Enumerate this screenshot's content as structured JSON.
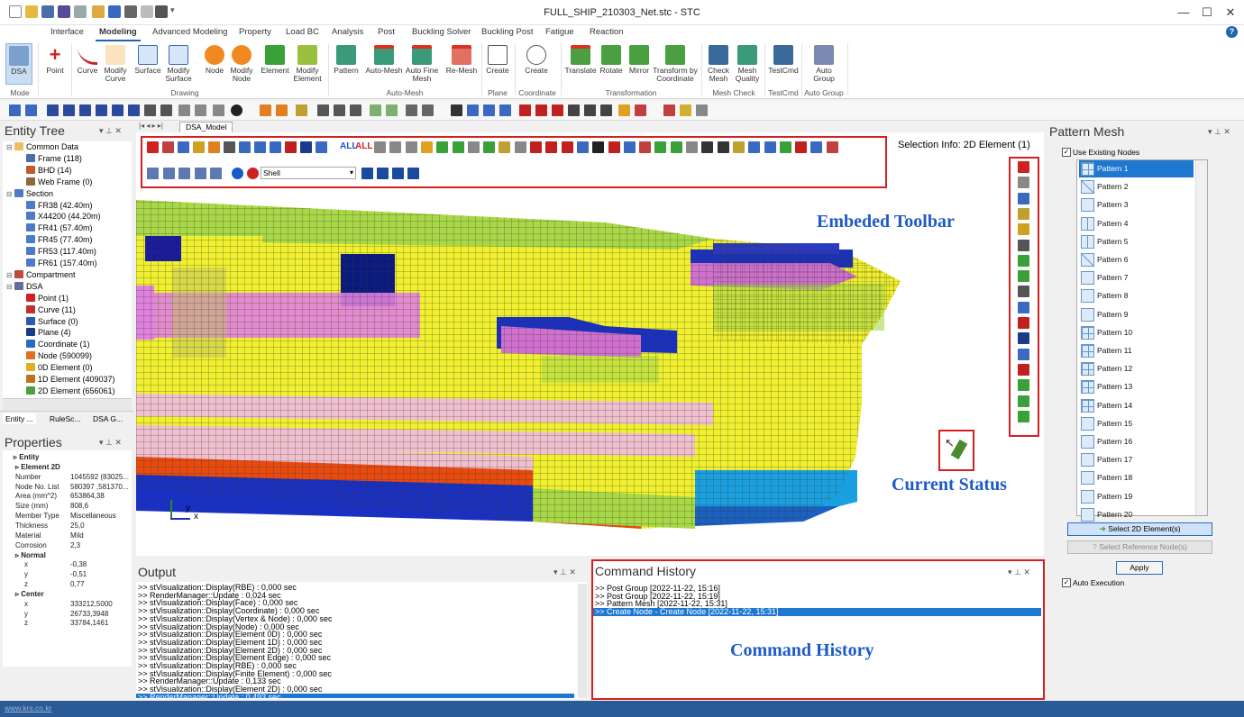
{
  "window": {
    "title": "FULL_SHIP_210303_Net.stc - STC"
  },
  "ribbon_tabs": [
    "Interface",
    "Modeling",
    "Advanced Modeling",
    "Property",
    "Load BC",
    "Analysis",
    "Post",
    "Buckling Solver",
    "Buckling Post",
    "Fatigue",
    "Reaction"
  ],
  "active_tab": "Modeling",
  "ribbon": {
    "dsa": "DSA",
    "point": "Point",
    "curve": "Curve",
    "modify_curve": "Modify Curve",
    "surface": "Surface",
    "modify_surface": "Modify Surface",
    "node": "Node",
    "modify_node": "Modify Node",
    "element": "Element",
    "modify_element": "Modify Element",
    "pattern": "Pattern",
    "auto_mesh": "Auto-Mesh",
    "auto_fine_mesh": "Auto Fine Mesh",
    "re_mesh": "Re-Mesh",
    "create_plane": "Create",
    "create_coord": "Create",
    "translate": "Translate",
    "rotate": "Rotate",
    "mirror": "Mirror",
    "transform": "Transform by Coordinate",
    "check_mesh": "Check Mesh",
    "mesh_quality": "Mesh Quality",
    "testcmd": "TestCmd",
    "auto_group": "Auto Group",
    "groups": {
      "mode": "Mode",
      "drawing": "Drawing",
      "auto_mesh": "Auto-Mesh",
      "plane": "Plane",
      "coordinate": "Coordinate",
      "transformation": "Transformation",
      "mesh_check": "Mesh Check",
      "testcmd": "TestCmd",
      "auto_group": "Auto Group"
    }
  },
  "entity_tree": {
    "title": "Entity Tree",
    "items": [
      {
        "label": "Common Data",
        "level": 0,
        "color": "#e8c060"
      },
      {
        "label": "Frame (118)",
        "level": 1,
        "color": "#4a6fa8"
      },
      {
        "label": "BHD (14)",
        "level": 1,
        "color": "#c45a2a"
      },
      {
        "label": "Web Frame (0)",
        "level": 1,
        "color": "#8a6a3a"
      },
      {
        "label": "Section",
        "level": 0,
        "color": "#4a7ac8"
      },
      {
        "label": "FR38 (42.40m)",
        "level": 1,
        "color": "#4a7ac8"
      },
      {
        "label": "X44200 (44.20m)",
        "level": 1,
        "color": "#4a7ac8"
      },
      {
        "label": "FR41 (57.40m)",
        "level": 1,
        "color": "#4a7ac8"
      },
      {
        "label": "FR45 (77.40m)",
        "level": 1,
        "color": "#4a7ac8"
      },
      {
        "label": "FR53 (117.40m)",
        "level": 1,
        "color": "#4a7ac8"
      },
      {
        "label": "FR61 (157.40m)",
        "level": 1,
        "color": "#4a7ac8"
      },
      {
        "label": "Compartment",
        "level": 0,
        "color": "#c04a3a"
      },
      {
        "label": "DSA",
        "level": 0,
        "color": "#6a6a9a"
      },
      {
        "label": "Point (1)",
        "level": 1,
        "color": "#d02020"
      },
      {
        "label": "Curve (11)",
        "level": 1,
        "color": "#c03030"
      },
      {
        "label": "Surface (0)",
        "level": 1,
        "color": "#2a5ab0"
      },
      {
        "label": "Plane (4)",
        "level": 1,
        "color": "#1a3a8a"
      },
      {
        "label": "Coordinate (1)",
        "level": 1,
        "color": "#2a6ac0"
      },
      {
        "label": "Node (590099)",
        "level": 1,
        "color": "#e07020"
      },
      {
        "label": "0D Element (0)",
        "level": 1,
        "color": "#e0b020"
      },
      {
        "label": "1D Element (409037)",
        "level": 1,
        "color": "#c07020"
      },
      {
        "label": "2D Element (656061)",
        "level": 1,
        "color": "#4aa040"
      }
    ],
    "bottom_tabs": [
      "Entity ...",
      "RuleSc...",
      "DSA G..."
    ]
  },
  "properties": {
    "title": "Properties",
    "rows": [
      {
        "k": "Entity",
        "v": "",
        "bold": true,
        "level": 0
      },
      {
        "k": "Element 2D",
        "v": "",
        "bold": true,
        "level": 1
      },
      {
        "k": "Number",
        "v": "1045592 (83025...",
        "level": 1
      },
      {
        "k": "Node No. List",
        "v": "580397 ,581370...",
        "level": 1
      },
      {
        "k": "Area (mm^2)",
        "v": "653864,38",
        "level": 1
      },
      {
        "k": "Size (mm)",
        "v": "808,6",
        "level": 1
      },
      {
        "k": "Member Type",
        "v": "Miscellaneous",
        "level": 1
      },
      {
        "k": "Thickness",
        "v": "25,0",
        "level": 1
      },
      {
        "k": "Material",
        "v": "Mild",
        "level": 1
      },
      {
        "k": "Corrosion",
        "v": "2,3",
        "level": 1
      },
      {
        "k": "Normal",
        "v": "",
        "bold": true,
        "level": 1
      },
      {
        "k": "x",
        "v": "-0,38",
        "level": 2
      },
      {
        "k": "y",
        "v": "-0,51",
        "level": 2
      },
      {
        "k": "z",
        "v": "0,77",
        "level": 2
      },
      {
        "k": "Center",
        "v": "",
        "bold": true,
        "level": 1
      },
      {
        "k": "x",
        "v": "333212,5000",
        "level": 2
      },
      {
        "k": "y",
        "v": "26733,3948",
        "level": 2
      },
      {
        "k": "z",
        "v": "33784,1461",
        "level": 2
      }
    ]
  },
  "viewport": {
    "tab": "DSA_Model",
    "selection_info": "Selection Info: 2D Element (1)",
    "element_type": "Shell",
    "all_label_1": "ALL",
    "all_label_2": "ALL",
    "axis_y": "y",
    "axis_x": "x",
    "ann_toolbar": "Embeded Toolbar",
    "ann_status": "Current Status"
  },
  "output": {
    "title": "Output",
    "lines": [
      ">> stVisualization::Display(RBE) : 0,000 sec",
      ">> RenderManager::Update : 0,024 sec",
      ">> stVisualization::Display(Face) : 0,000 sec",
      ">> stVisualization::Display(Coordinate) : 0,000 sec",
      ">> stVisualization::Display(Vertex & Node) : 0,000 sec",
      ">> stVisualization::Display(Node) : 0,000 sec",
      ">> stVisualization::Display(Element 0D) : 0,000 sec",
      ">> stVisualization::Display(Element 1D) : 0,000 sec",
      ">> stVisualization::Display(Element 2D) : 0,000 sec",
      ">> stVisualization::Display(Element Edge) : 0,000 sec",
      ">> stVisualization::Display(RBE) : 0,000 sec",
      ">> stVisualization::Display(Finite Element) : 0,000 sec",
      ">> RenderManager::Update : 0,133 sec",
      ">> stVisualization::Display(Element 2D) : 0,000 sec",
      ">> RenderManager::Update : 0,493 sec"
    ]
  },
  "command_history": {
    "title": "Command History",
    "lines": [
      ">> Post Group  [2022-11-22, 15:16]",
      ">> Post Group  [2022-11-22, 15:19]",
      ">> Pattern Mesh  [2022-11-22, 15:31]",
      ">> Create Node - Create Node  [2022-11-22, 15:31]"
    ],
    "annotation": "Command History"
  },
  "pattern_mesh": {
    "title": "Pattern Mesh",
    "use_existing_nodes": "Use Existing Nodes",
    "patterns": [
      "Pattern 1",
      "Pattern 2",
      "Pattern 3",
      "Pattern 4",
      "Pattern 5",
      "Pattern 6",
      "Pattern 7",
      "Pattern 8",
      "Pattern 9",
      "Pattern 10",
      "Pattern 11",
      "Pattern 12",
      "Pattern 13",
      "Pattern 14",
      "Pattern 15",
      "Pattern 16",
      "Pattern 17",
      "Pattern 18",
      "Pattern 19",
      "Pattern 20"
    ],
    "selected": "Pattern 1",
    "select_2d": "Select 2D Element(s)",
    "select_ref": "Select Reference Node(s)",
    "apply": "Apply",
    "auto_execution": "Auto Execution"
  },
  "status_bar": {
    "url": "www.krs.co.kr"
  }
}
